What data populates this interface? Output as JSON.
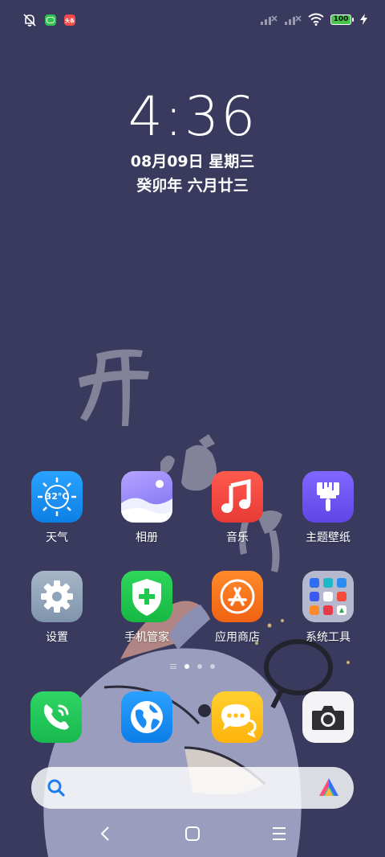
{
  "status_bar": {
    "left_icons": [
      "bell-off-icon",
      "wechat-mini-icon",
      "news-mini-icon"
    ],
    "news_icon_text": "头条",
    "battery_level": "100",
    "signal_1": "signal-off-icon",
    "signal_2": "signal-off-icon",
    "wifi": "wifi-icon",
    "charging": "charging-bolt-icon"
  },
  "lock_info": {
    "time": "4:36",
    "date": "08月09日 星期三",
    "lunar": "癸卯年 六月廿三"
  },
  "weather_badge": "32°C",
  "apps_row1": [
    {
      "label": "天气",
      "icon": "weather-icon"
    },
    {
      "label": "相册",
      "icon": "gallery-icon"
    },
    {
      "label": "音乐",
      "icon": "music-icon"
    },
    {
      "label": "主题壁纸",
      "icon": "theme-brush-icon"
    }
  ],
  "apps_row2": [
    {
      "label": "设置",
      "icon": "settings-gear-icon"
    },
    {
      "label": "手机管家",
      "icon": "security-shield-icon"
    },
    {
      "label": "应用商店",
      "icon": "app-store-icon"
    },
    {
      "label": "系统工具",
      "icon": "folder-icon"
    }
  ],
  "dock": [
    {
      "icon": "phone-icon"
    },
    {
      "icon": "browser-globe-icon"
    },
    {
      "icon": "messages-icon"
    },
    {
      "icon": "camera-icon"
    }
  ],
  "page_indicator": {
    "pages": 3,
    "current": 1
  },
  "search_bar": {
    "left_icon": "search-icon",
    "right_icon": "assistant-logo-icon"
  },
  "nav_bar": [
    "back-icon",
    "home-icon",
    "recents-menu-icon"
  ],
  "colors": {
    "wallpaper": "#393a5e",
    "weather_blue": "#1e8ff0",
    "music_red": "#f0463e",
    "theme_purple": "#6f55f2",
    "settings_gray": "#8fa3ba",
    "security_green": "#1ec94f",
    "store_orange": "#f77618",
    "phone_green": "#22c55e",
    "browser_blue": "#1a8cf5",
    "messages_yellow": "#ffc21c"
  }
}
